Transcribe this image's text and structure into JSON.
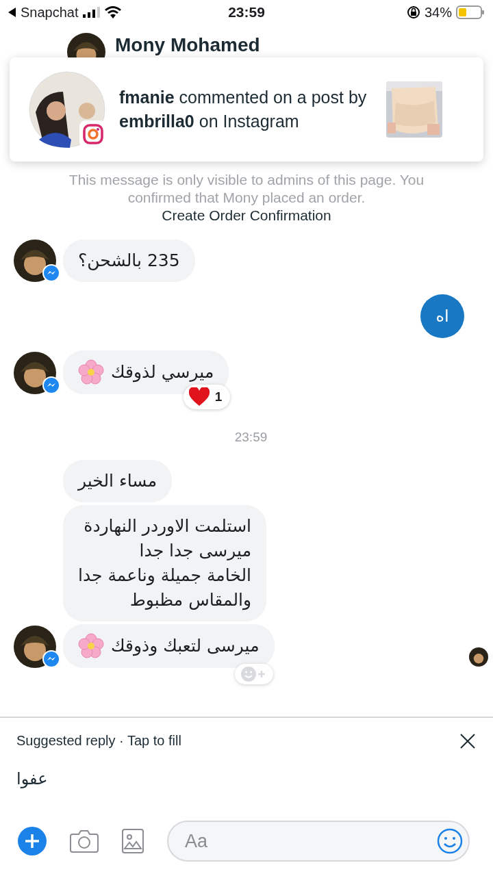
{
  "status_bar": {
    "back_app": "Snapchat",
    "time": "23:59",
    "battery": "34%"
  },
  "header": {
    "name": "Mony Mohamed"
  },
  "notification": {
    "text": "**fmanie** commented on a post by **embrilla0** on Instagram"
  },
  "system_notes": [
    {
      "kind": "note",
      "text": "This message is only visible to admins of this page. You confirmed that Mony placed an order."
    },
    {
      "kind": "action",
      "text": "Create Order Confirmation"
    }
  ],
  "messages": [
    {
      "kind": "incoming",
      "text": "235 بالشحن؟",
      "avatar": true,
      "flower": false
    },
    {
      "kind": "outgoing",
      "text": "اه"
    },
    {
      "kind": "incoming",
      "text": "ميرسي لذوقك",
      "avatar": true,
      "flower": true,
      "reaction": {
        "count": "1"
      }
    },
    {
      "kind": "timestamp",
      "text": "23:59"
    },
    {
      "kind": "incoming",
      "text": "مساء الخير",
      "avatar": false,
      "flower": false
    },
    {
      "kind": "incoming",
      "text": "استلمت الاوردر النهاردة\nميرسى جدا جدا\nالخامة جميلة وناعمة جدا\nوالمقاس مظبوط",
      "avatar": false,
      "flower": false
    },
    {
      "kind": "incoming",
      "text": "ميرسى لتعبك وذوقك",
      "avatar": true,
      "flower": true,
      "seen": true,
      "react_button": true
    }
  ],
  "suggestion": {
    "label": "Suggested reply · Tap to fill",
    "reply": "عفوا"
  },
  "composer": {
    "placeholder": "Aa"
  }
}
